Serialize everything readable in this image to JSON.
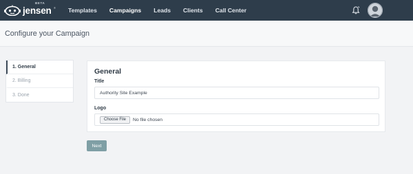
{
  "app": {
    "brand": "jensen",
    "beta_label": "BETA",
    "trademark": "®"
  },
  "nav": {
    "items": [
      {
        "label": "Templates"
      },
      {
        "label": "Campaigns",
        "active": true
      },
      {
        "label": "Leads"
      },
      {
        "label": "Clients"
      },
      {
        "label": "Call Center"
      }
    ]
  },
  "header": {
    "title": "Configure your Campaign"
  },
  "steps": [
    {
      "label": "1. General",
      "active": true
    },
    {
      "label": "2. Billing"
    },
    {
      "label": "3. Done"
    }
  ],
  "form": {
    "section_title": "General",
    "title_label": "Title",
    "title_value": "Authority Site Example",
    "logo_label": "Logo",
    "file_button_label": "Choose File",
    "file_status": "No file chosen"
  },
  "actions": {
    "next_label": "Next"
  },
  "icons": {
    "logo": "robot-mascot-icon",
    "notifications": "bell-icon",
    "profile": "avatar-icon"
  },
  "colors": {
    "topbar": "#2e3d4b",
    "next_button": "#7f9fa5",
    "background": "#f2f3f5"
  }
}
